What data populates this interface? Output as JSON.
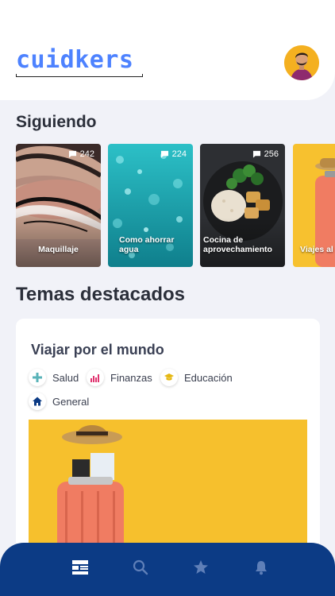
{
  "app": {
    "brand": "cuidkers"
  },
  "following": {
    "title": "Siguiendo",
    "cards": [
      {
        "label": "Maquillaje",
        "count": "242"
      },
      {
        "label": "Como ahorrar agua",
        "count": "224"
      },
      {
        "label": "Cocina de aprovechamiento",
        "count": "256"
      },
      {
        "label": "Viajes al extran",
        "count": ""
      }
    ]
  },
  "featured": {
    "title": "Temas destacados",
    "topic": {
      "title": "Viajar por el mundo",
      "tags": [
        {
          "label": "Salud",
          "icon": "plus-icon",
          "color": "#59b3b8"
        },
        {
          "label": "Finanzas",
          "icon": "bar-chart-icon",
          "color": "#e0336f"
        },
        {
          "label": "Educación",
          "icon": "graduation-cap-icon",
          "color": "#e5b711"
        },
        {
          "label": "General",
          "icon": "home-icon",
          "color": "#0c3b85"
        }
      ]
    }
  },
  "nav": {
    "items": [
      {
        "icon": "feed-icon",
        "active": true
      },
      {
        "icon": "search-icon",
        "active": false
      },
      {
        "icon": "star-icon",
        "active": false
      },
      {
        "icon": "bell-icon",
        "active": false
      }
    ]
  },
  "colors": {
    "brand": "#4d82ff",
    "nav_bg": "#0c3b85",
    "background": "#f1f2f8"
  }
}
